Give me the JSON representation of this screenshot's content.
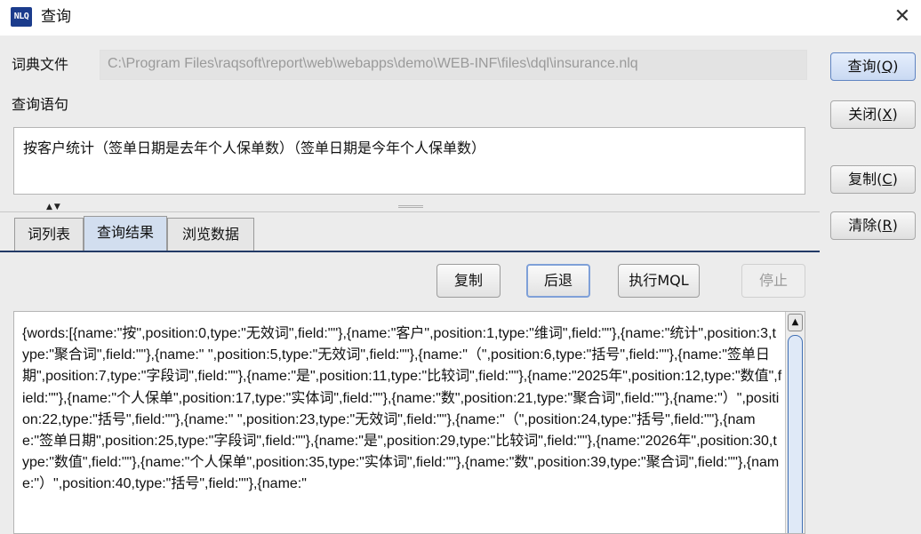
{
  "window": {
    "icon_text": "NLQ",
    "title": "查询",
    "close_glyph": "✕"
  },
  "form": {
    "dict_label": "词典文件",
    "dict_path": "C:\\Program Files\\raqsoft\\report\\web\\webapps\\demo\\WEB-INF\\files\\dql\\insurance.nlq",
    "query_label": "查询语句",
    "query_text": "按客户统计（签单日期是去年个人保单数）（签单日期是今年个人保单数）"
  },
  "side_buttons": {
    "query": {
      "text": "查询(",
      "key": "Q",
      "end": ")"
    },
    "close": {
      "text": "关闭(",
      "key": "X",
      "end": ")"
    },
    "copy": {
      "text": "复制(",
      "key": "C",
      "end": ")"
    },
    "clear": {
      "text": "清除(",
      "key": "R",
      "end": ")"
    }
  },
  "splitter": {
    "arrows": "▲▼"
  },
  "tabs": [
    {
      "label": "词列表"
    },
    {
      "label": "查询结果"
    },
    {
      "label": "浏览数据"
    }
  ],
  "toolbar": {
    "copy": "复制",
    "back": "后退",
    "exec_mql": "执行MQL",
    "stop": "停止"
  },
  "result": {
    "text": "{words:[{name:\"按\",position:0,type:\"无效词\",field:\"\"},{name:\"客户\",position:1,type:\"维词\",field:\"\"},{name:\"统计\",position:3,type:\"聚合词\",field:\"\"},{name:\" \",position:5,type:\"无效词\",field:\"\"},{name:\"（\",position:6,type:\"括号\",field:\"\"},{name:\"签单日期\",position:7,type:\"字段词\",field:\"\"},{name:\"是\",position:11,type:\"比较词\",field:\"\"},{name:\"2025年\",position:12,type:\"数值\",field:\"\"},{name:\"个人保单\",position:17,type:\"实体词\",field:\"\"},{name:\"数\",position:21,type:\"聚合词\",field:\"\"},{name:\"）\",position:22,type:\"括号\",field:\"\"},{name:\" \",position:23,type:\"无效词\",field:\"\"},{name:\"（\",position:24,type:\"括号\",field:\"\"},{name:\"签单日期\",position:25,type:\"字段词\",field:\"\"},{name:\"是\",position:29,type:\"比较词\",field:\"\"},{name:\"2026年\",position:30,type:\"数值\",field:\"\"},{name:\"个人保单\",position:35,type:\"实体词\",field:\"\"},{name:\"数\",position:39,type:\"聚合词\",field:\"\"},{name:\"）\",position:40,type:\"括号\",field:\"\"},{name:\""
  },
  "scrollbar": {
    "up_glyph": "▲"
  }
}
